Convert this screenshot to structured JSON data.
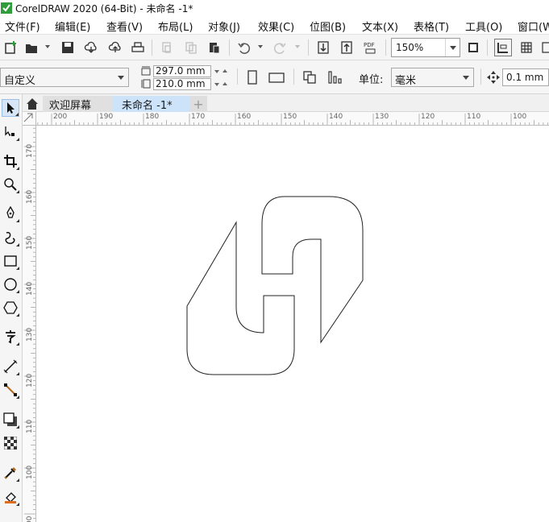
{
  "window": {
    "title": "CorelDRAW 2020 (64-Bit) - 未命名 -1*"
  },
  "menu": {
    "file": "文件(F)",
    "edit": "编辑(E)",
    "view": "查看(V)",
    "layout": "布局(L)",
    "object": "对象(J)",
    "effects": "效果(C)",
    "bitmaps": "位图(B)",
    "text": "文本(X)",
    "table": "表格(T)",
    "tools": "工具(O)",
    "window": "窗口(W"
  },
  "toolbar": {
    "zoom_value": "150%",
    "pdf_label": "PDF"
  },
  "property_bar": {
    "page_preset": "自定义",
    "page_width": "297.0 mm",
    "page_height": "210.0 mm",
    "units_label": "单位:",
    "units_value": "毫米",
    "nudge_value": "0.1 mm"
  },
  "tabs": {
    "welcome": "欢迎屏幕",
    "document": "未命名 -1*"
  },
  "rulers": {
    "horizontal": [
      "200",
      "190",
      "180",
      "170",
      "160",
      "150",
      "140",
      "130",
      "120",
      "110",
      "100"
    ],
    "vertical": [
      "170",
      "160",
      "150",
      "140",
      "130",
      "120",
      "110",
      "100",
      "90"
    ]
  },
  "icons": {
    "toolbox": [
      "pick-tool-icon",
      "shape-tool-icon",
      "crop-tool-icon",
      "zoom-tool-icon",
      "freehand-tool-icon",
      "artistic-media-icon",
      "rectangle-tool-icon",
      "ellipse-tool-icon",
      "polygon-tool-icon",
      "text-tool-icon",
      "dimension-tool-icon",
      "connector-tool-icon",
      "drop-shadow-icon",
      "transparency-icon",
      "eyedropper-icon",
      "interactive-fill-icon"
    ]
  },
  "colors": {
    "accent_tab": "#cde3fa",
    "selected_tool": "#d6e6f7"
  }
}
